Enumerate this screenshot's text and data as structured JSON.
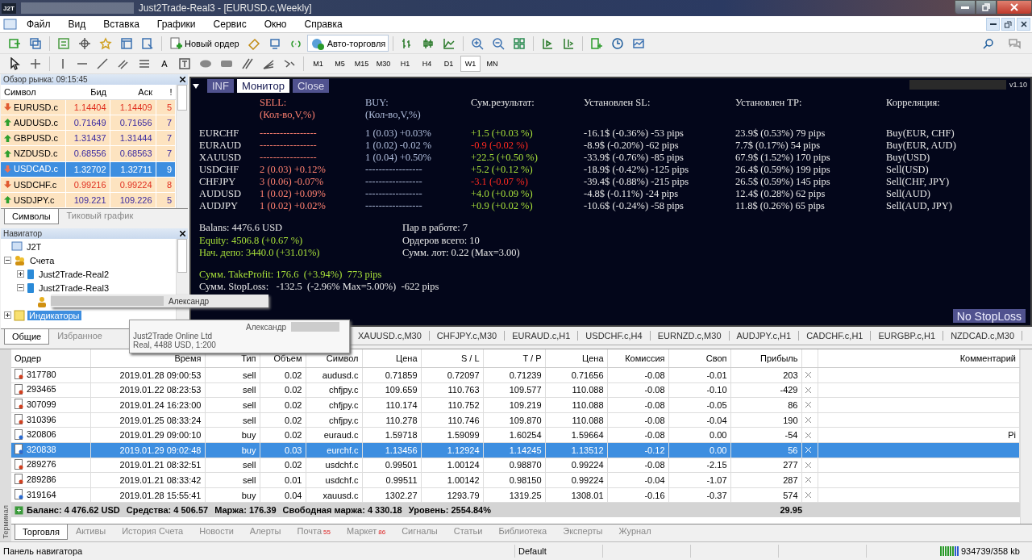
{
  "window": {
    "logo": "J2T",
    "title": "Just2Trade-Real3 - [EURUSD.c,Weekly]"
  },
  "menu": [
    "Файл",
    "Вид",
    "Вставка",
    "Графики",
    "Сервис",
    "Окно",
    "Справка"
  ],
  "toolbar": {
    "new_order": "Новый ордер",
    "auto_trading": "Авто-торговля",
    "text_tool": "A"
  },
  "periods": [
    {
      "label": "M1",
      "selected": false
    },
    {
      "label": "M5",
      "selected": false
    },
    {
      "label": "M15",
      "selected": false
    },
    {
      "label": "M30",
      "selected": false
    },
    {
      "label": "H1",
      "selected": false
    },
    {
      "label": "H4",
      "selected": false
    },
    {
      "label": "D1",
      "selected": false
    },
    {
      "label": "W1",
      "selected": true
    },
    {
      "label": "MN",
      "selected": false
    }
  ],
  "market_watch": {
    "title": "Обзор рынка: 09:15:45",
    "columns": [
      "Символ",
      "Бид",
      "Аск",
      "!"
    ],
    "rows": [
      {
        "symbol": "EURUSD.c",
        "bid": "1.14404",
        "ask": "1.14409",
        "spread": "5",
        "rising": false,
        "selected": false
      },
      {
        "symbol": "AUDUSD.c",
        "bid": "0.71649",
        "ask": "0.71656",
        "spread": "7",
        "rising": true,
        "selected": false
      },
      {
        "symbol": "GBPUSD.c",
        "bid": "1.31437",
        "ask": "1.31444",
        "spread": "7",
        "rising": true,
        "selected": false
      },
      {
        "symbol": "NZDUSD.c",
        "bid": "0.68556",
        "ask": "0.68563",
        "spread": "7",
        "rising": true,
        "selected": false
      },
      {
        "symbol": "USDCAD.c",
        "bid": "1.32702",
        "ask": "1.32711",
        "spread": "9",
        "rising": false,
        "selected": true
      },
      {
        "symbol": "USDCHF.c",
        "bid": "0.99216",
        "ask": "0.99224",
        "spread": "8",
        "rising": false,
        "selected": false
      },
      {
        "symbol": "USDJPY.c",
        "bid": "109.221",
        "ask": "109.226",
        "spread": "5",
        "rising": true,
        "selected": false
      }
    ],
    "tabs": [
      {
        "label": "Символы",
        "selected": true
      },
      {
        "label": "Тиковый график",
        "selected": false
      }
    ]
  },
  "navigator": {
    "title": "Навигатор",
    "tree": [
      {
        "label": "J2T",
        "kind": "root",
        "selected": false
      },
      {
        "label": "Счета",
        "kind": "accounts",
        "selected": false,
        "expanded": true,
        "children": [
          {
            "label": "Just2Trade-Real2",
            "kind": "server",
            "selected": false,
            "expanded": false
          },
          {
            "label": "Just2Trade-Real3",
            "kind": "server",
            "selected": false,
            "expanded": true,
            "children": [
              {
                "label": "Александр",
                "kind": "account",
                "selected": false
              }
            ]
          }
        ]
      },
      {
        "label": "Индикаторы",
        "kind": "indicators",
        "selected": true,
        "expanded": false
      }
    ],
    "tabs": [
      {
        "label": "Общие",
        "selected": true
      },
      {
        "label": "Избранное",
        "selected": false
      }
    ]
  },
  "account_tooltip": {
    "name": "Александр",
    "lines": [
      "Just2Trade Online Ltd",
      "Real, 4488 USD, 1:200"
    ]
  },
  "monitor": {
    "buttons": [
      {
        "label": "INF",
        "selected": false
      },
      {
        "label": "Монитор",
        "selected": true
      },
      {
        "label": "Close",
        "selected": false
      }
    ],
    "version": "v1.10",
    "headers": {
      "sell": [
        "SELL:",
        "(Кол-во,V,%)"
      ],
      "buy": [
        "BUY:",
        "(Кол-во,V,%)"
      ],
      "result": "Сум.результат:",
      "sl": "Установлен SL:",
      "tp": "Установлен TP:",
      "corr": "Корреляция:"
    },
    "pairs": [
      {
        "pair": "EURCHF",
        "sell": "-----------------",
        "buy": "1 (0.03) +0.03%",
        "result": "+1.5 (+0.03 %)",
        "positive": true,
        "sl": "-16.1$ (-0.36%) -53 pips",
        "tp": "23.9$ (0.53%) 79 pips",
        "corr": "Buy(EUR, CHF)"
      },
      {
        "pair": "EURAUD",
        "sell": "-----------------",
        "buy": "1 (0.02) -0.02 %",
        "result": "-0.9 (-0.02 %)",
        "positive": false,
        "sl": "-8.9$ (-0.20%) -62 pips",
        "tp": "7.7$ (0.17%) 54 pips",
        "corr": "Buy(EUR, AUD)"
      },
      {
        "pair": "XAUUSD",
        "sell": "-----------------",
        "buy": "1 (0.04) +0.50%",
        "result": "+22.5 (+0.50 %)",
        "positive": true,
        "sl": "-33.9$ (-0.76%) -85 pips",
        "tp": "67.9$ (1.52%) 170 pips",
        "corr": "Buy(USD)"
      },
      {
        "pair": "USDCHF",
        "sell": "2 (0.03) +0.12%",
        "buy": "-----------------",
        "result": "+5.2 (+0.12 %)",
        "positive": true,
        "sl": "-18.9$ (-0.42%) -125 pips",
        "tp": "26.4$ (0.59%) 199 pips",
        "corr": "Sell(USD)"
      },
      {
        "pair": "CHFJPY",
        "sell": "3 (0.06) -0.07%",
        "buy": "-----------------",
        "result": "-3.1 (-0.07 %)",
        "positive": false,
        "sl": "-39.4$ (-0.88%) -215 pips",
        "tp": "26.5$ (0.59%) 145 pips",
        "corr": "Sell(CHF, JPY)"
      },
      {
        "pair": "AUDUSD",
        "sell": "1 (0.02) +0.09%",
        "buy": "-----------------",
        "result": "+4.0 (+0.09 %)",
        "positive": true,
        "sl": "-4.8$ (-0.11%) -24 pips",
        "tp": "12.4$ (0.28%) 62 pips",
        "corr": "Sell(AUD)"
      },
      {
        "pair": "AUDJPY",
        "sell": "1 (0.02) +0.02%",
        "buy": "-----------------",
        "result": "+0.9 (+0.02 %)",
        "positive": true,
        "sl": "-10.6$ (-0.24%) -58 pips",
        "tp": "11.8$ (0.26%) 65 pips",
        "corr": "Sell(AUD, JPY)"
      }
    ],
    "summary_left": [
      {
        "text": "Balans: 4476.6 USD",
        "highlighted": false
      },
      {
        "text": "Equity: 4506.8 (+0.67 %)",
        "highlighted": true
      },
      {
        "text": "Нач. депо: 3440.0  (+31.01%)",
        "highlighted": true
      }
    ],
    "summary_right": [
      {
        "text": "Пар в работе: 7",
        "highlighted": false
      },
      {
        "text": "Ордеров всего: 10",
        "highlighted": false
      },
      {
        "text": "Сумм. лот: 0.22  (Max=3.00)",
        "highlighted": false
      }
    ],
    "totals": [
      {
        "text": "Сумм. TakeProfit: 176.6  (+3.94%)  773 pips",
        "highlighted": true
      },
      {
        "text": "Сумм. StopLoss:   -132.5  (-2.96% Max=5.00%)  -622 pips",
        "highlighted": false
      }
    ],
    "stoploss_button": "No StopLoss"
  },
  "chart_tabs": [
    "XAUUSD.c,M30",
    "CHFJPY.c,M30",
    "EURAUD.c,H1",
    "USDCHF.c,H4",
    "EURNZD.c,M30",
    "AUDJPY.c,H1",
    "CADCHF.c,H1",
    "EURGBP.c,H1",
    "NZDCAD.c,M30"
  ],
  "terminal": {
    "side_label": "Терминал",
    "columns": [
      "Ордер",
      "Время",
      "Тип",
      "Объем",
      "Символ",
      "Цена",
      "S / L",
      "T / P",
      "Цена",
      "Комиссия",
      "Своп",
      "Прибыль",
      "Комментарий"
    ],
    "rows": [
      {
        "kind": "sell",
        "selected": false,
        "cells": [
          "317780",
          "2019.01.28 09:00:53",
          "sell",
          "0.02",
          "audusd.c",
          "0.71859",
          "0.72097",
          "0.71239",
          "0.71656",
          "-0.08",
          "-0.01",
          "203"
        ]
      },
      {
        "kind": "sell",
        "selected": false,
        "cells": [
          "293465",
          "2019.01.22 08:23:53",
          "sell",
          "0.02",
          "chfjpy.c",
          "109.659",
          "110.763",
          "109.577",
          "110.088",
          "-0.08",
          "-0.10",
          "-429"
        ]
      },
      {
        "kind": "sell",
        "selected": false,
        "cells": [
          "307099",
          "2019.01.24 16:23:00",
          "sell",
          "0.02",
          "chfjpy.c",
          "110.174",
          "110.752",
          "109.219",
          "110.088",
          "-0.08",
          "-0.05",
          "86"
        ]
      },
      {
        "kind": "sell",
        "selected": false,
        "cells": [
          "310396",
          "2019.01.25 08:33:24",
          "sell",
          "0.02",
          "chfjpy.c",
          "110.278",
          "110.746",
          "109.870",
          "110.088",
          "-0.08",
          "-0.04",
          "190"
        ]
      },
      {
        "kind": "buy",
        "selected": false,
        "cells": [
          "320806",
          "2019.01.29 09:00:10",
          "buy",
          "0.02",
          "euraud.c",
          "1.59718",
          "1.59099",
          "1.60254",
          "1.59664",
          "-0.08",
          "0.00",
          "-54"
        ],
        "comment": "Pi"
      },
      {
        "kind": "buy",
        "selected": true,
        "cells": [
          "320838",
          "2019.01.29 09:02:48",
          "buy",
          "0.03",
          "eurchf.c",
          "1.13456",
          "1.12924",
          "1.14245",
          "1.13512",
          "-0.12",
          "0.00",
          "56"
        ]
      },
      {
        "kind": "sell",
        "selected": false,
        "cells": [
          "289276",
          "2019.01.21 08:32:51",
          "sell",
          "0.02",
          "usdchf.c",
          "0.99501",
          "1.00124",
          "0.98870",
          "0.99224",
          "-0.08",
          "-2.15",
          "277"
        ]
      },
      {
        "kind": "sell",
        "selected": false,
        "cells": [
          "289286",
          "2019.01.21 08:33:42",
          "sell",
          "0.01",
          "usdchf.c",
          "0.99511",
          "1.00142",
          "0.98150",
          "0.99224",
          "-0.04",
          "-1.07",
          "287"
        ]
      },
      {
        "kind": "buy",
        "selected": false,
        "cells": [
          "319164",
          "2019.01.28 15:55:41",
          "buy",
          "0.04",
          "xauusd.c",
          "1302.27",
          "1293.79",
          "1319.25",
          "1308.01",
          "-0.16",
          "-0.37",
          "574"
        ]
      }
    ],
    "summary": [
      {
        "label": "Баланс:",
        "value": "4 476.62 USD"
      },
      {
        "label": "Средства:",
        "value": "4 506.57"
      },
      {
        "label": "Маржа:",
        "value": "176.39"
      },
      {
        "label": "Свободная маржа:",
        "value": "4 330.18"
      },
      {
        "label": "Уровень:",
        "value": "2554.84%"
      }
    ],
    "total_profit": "29.95",
    "tabs": [
      {
        "label": "Торговля",
        "selected": true
      },
      {
        "label": "Активы",
        "selected": false
      },
      {
        "label": "История Счета",
        "selected": false
      },
      {
        "label": "Новости",
        "selected": false
      },
      {
        "label": "Алерты",
        "selected": false
      },
      {
        "label": "Почта",
        "badge": "55",
        "selected": false
      },
      {
        "label": "Маркет",
        "badge": "86",
        "selected": false
      },
      {
        "label": "Сигналы",
        "selected": false
      },
      {
        "label": "Статьи",
        "selected": false
      },
      {
        "label": "Библиотека",
        "selected": false
      },
      {
        "label": "Эксперты",
        "selected": false
      },
      {
        "label": "Журнал",
        "selected": false
      }
    ]
  },
  "status_bar": {
    "hint": "Панель навигатора",
    "profile": "Default",
    "traffic": "934739/358 kb"
  }
}
